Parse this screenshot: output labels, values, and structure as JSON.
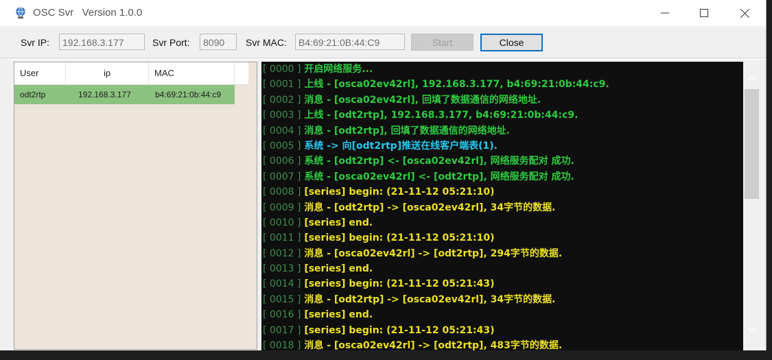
{
  "window": {
    "title": "OSC Svr   Version 1.0.0"
  },
  "toolbar": {
    "ip_label": "Svr IP:",
    "ip_value": "192.168.3.177",
    "port_label": "Svr Port:",
    "port_value": "8090",
    "mac_label": "Svr MAC:",
    "mac_value": "B4:69:21:0B:44:C9",
    "start_label": "Start",
    "close_label": "Close"
  },
  "user_table": {
    "columns": [
      "User",
      "ip",
      "MAC"
    ],
    "rows": [
      {
        "user": "odt2rtp",
        "ip": "192.168.3.177",
        "mac": "b4:69:21:0b:44:c9"
      }
    ]
  },
  "colors": {
    "green": "#2ecc40",
    "cyan": "#27c8f0",
    "yellow": "#ece022",
    "selected_row": "#8cc27f",
    "accent": "#0f6ec2"
  },
  "log": [
    {
      "idx": "[ 0000 ]",
      "text": "开启网络服务...",
      "color": "green"
    },
    {
      "idx": "[ 0001 ]",
      "text": "上线  - [osca02ev42rl], 192.168.3.177, b4:69:21:0b:44:c9.",
      "color": "green"
    },
    {
      "idx": "[ 0002 ]",
      "text": "消息  - [osca02ev42rl], 回填了数据通信的网络地址.",
      "color": "green"
    },
    {
      "idx": "[ 0003 ]",
      "text": "上线  - [odt2rtp], 192.168.3.177, b4:69:21:0b:44:c9.",
      "color": "green"
    },
    {
      "idx": "[ 0004 ]",
      "text": "消息  - [odt2rtp], 回填了数据通信的网络地址.",
      "color": "green"
    },
    {
      "idx": "[ 0005 ]",
      "text": "系统  -> 向[odt2rtp]推送在线客户端表(1).",
      "color": "cyan"
    },
    {
      "idx": "[ 0006 ]",
      "text": "系统  - [odt2rtp] <- [osca02ev42rl], 网络服务配对  成功.",
      "color": "green"
    },
    {
      "idx": "[ 0007 ]",
      "text": "系统  - [osca02ev42rl] <- [odt2rtp], 网络服务配对  成功.",
      "color": "green"
    },
    {
      "idx": "[ 0008 ]",
      "text": "[series] begin: (21-11-12 05:21:10)",
      "color": "yellow"
    },
    {
      "idx": "[ 0009 ]",
      "text": "消息  - [odt2rtp] -> [osca02ev42rl], 34字节的数据.",
      "color": "yellow"
    },
    {
      "idx": "[ 0010 ]",
      "text": "[series] end.",
      "color": "yellow"
    },
    {
      "idx": "[ 0011 ]",
      "text": "[series] begin: (21-11-12 05:21:10)",
      "color": "yellow"
    },
    {
      "idx": "[ 0012 ]",
      "text": "消息  - [osca02ev42rl] -> [odt2rtp], 294字节的数据.",
      "color": "yellow"
    },
    {
      "idx": "[ 0013 ]",
      "text": "[series] end.",
      "color": "yellow"
    },
    {
      "idx": "[ 0014 ]",
      "text": "[series] begin: (21-11-12 05:21:43)",
      "color": "yellow"
    },
    {
      "idx": "[ 0015 ]",
      "text": "消息  - [odt2rtp] -> [osca02ev42rl], 34字节的数据.",
      "color": "yellow"
    },
    {
      "idx": "[ 0016 ]",
      "text": "[series] end.",
      "color": "yellow"
    },
    {
      "idx": "[ 0017 ]",
      "text": "[series] begin: (21-11-12 05:21:43)",
      "color": "yellow"
    },
    {
      "idx": "[ 0018 ]",
      "text": "消息  - [osca02ev42rl] -> [odt2rtp], 483字节的数据.",
      "color": "yellow"
    }
  ]
}
